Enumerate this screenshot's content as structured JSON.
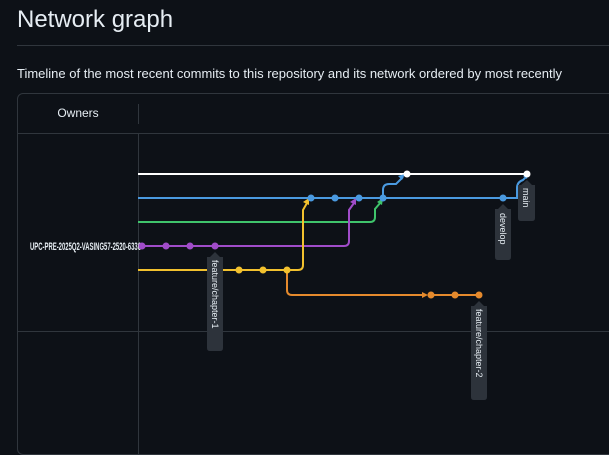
{
  "page": {
    "title": "Network graph",
    "description": "Timeline of the most recent commits to this repository and its network ordered by most recently"
  },
  "graph": {
    "owners_header": "Owners",
    "owner_label": "UPC-PRE-2025Q2-VASING57-2520-6336",
    "branch_labels": {
      "main": "main",
      "develop": "develop",
      "chapter1": "feature/chapter-1",
      "chapter2": "feature/chapter-2"
    },
    "colors": {
      "white": "#ffffff",
      "blue": "#4a9ae0",
      "green": "#3fc46b",
      "purple": "#a04cc9",
      "yellow": "#f2c12e",
      "orange": "#e58a2d",
      "label_bg": "#2d333b",
      "grid": "#30363d"
    }
  }
}
